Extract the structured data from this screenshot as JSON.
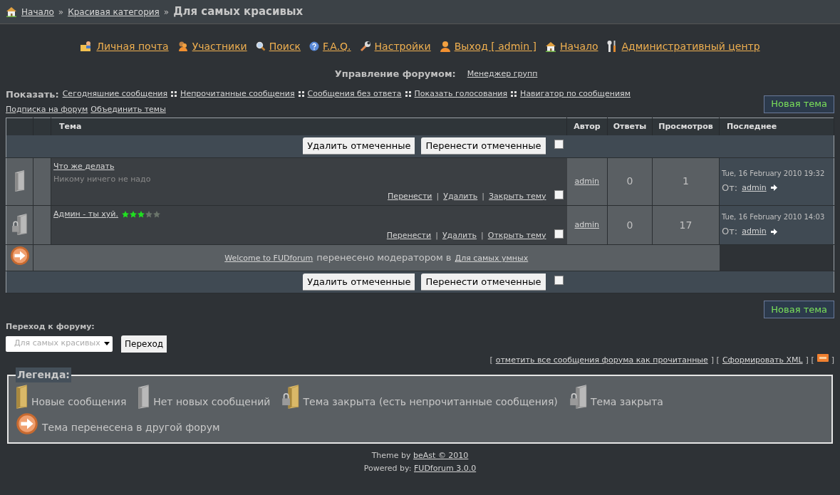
{
  "breadcrumb": {
    "links": [
      "Начало",
      "Красивая категория"
    ],
    "separator": "»",
    "current": "Для самых красивых"
  },
  "nav": [
    {
      "kind": "mail",
      "label": "Личная почта"
    },
    {
      "kind": "users",
      "label": "Участники"
    },
    {
      "kind": "search",
      "label": "Поиск"
    },
    {
      "kind": "help",
      "label": "F.A.Q."
    },
    {
      "kind": "wrench",
      "label": "Настройки"
    },
    {
      "kind": "user",
      "label": "Выход [ admin ]"
    },
    {
      "kind": "home",
      "label": "Начало"
    },
    {
      "kind": "tools",
      "label": "Административный центр"
    }
  ],
  "admin": {
    "label": "Управление форумом:",
    "link": "Менеджер групп"
  },
  "show": {
    "label": "Показать:",
    "links": [
      "Сегодняшние сообщения",
      "Непрочитанные сообщения",
      "Сообщения без ответа",
      "Показать голосования",
      "Навигатор по сообщениям"
    ],
    "links2": [
      "Подписка на форум",
      "Объединить темы"
    ]
  },
  "new_topic_top": "Новая тема",
  "table": {
    "columns": [
      "Тема",
      "Автор",
      "Ответы",
      "Просмотров",
      "Последнее"
    ],
    "bulk_top": {
      "buttons": [
        "Удалить отмеченные",
        "Перенести отмеченные"
      ],
      "checked": false
    },
    "rows": [
      {
        "kind": "topic",
        "locked": false,
        "title": "Что же делать",
        "subtitle": "Никому ничего не надо",
        "actions": [
          "Перенести",
          "Удалить",
          "Закрыть тему"
        ],
        "action_separator": "|",
        "checked": false,
        "author": "admin",
        "replies": "0",
        "views": "1",
        "date": "Tue, 16 February 2010 19:32",
        "from_label": "От:",
        "from": "admin"
      },
      {
        "kind": "topic",
        "locked": true,
        "title": "Админ - ты хуй.",
        "stars": 3,
        "actions": [
          "Перенести",
          "Удалить",
          "Открыть тему"
        ],
        "action_separator": "|",
        "checked": false,
        "author": "admin",
        "replies": "0",
        "views": "17",
        "date": "Tue, 16 February 2010 14:03",
        "from_label": "От:",
        "from": "admin"
      },
      {
        "kind": "moved",
        "link": "Welcome to FUDforum",
        "text": "перенесено модератором в",
        "target": "Для самых умных"
      }
    ],
    "bulk_bottom": {
      "buttons": [
        "Удалить отмеченные",
        "Перенести отмеченные"
      ],
      "checked": false
    }
  },
  "new_topic_bottom": "Новая тема",
  "jump": {
    "label": "Переход к форуму:",
    "value": "Для самых красивых",
    "button": "Переход"
  },
  "tools": {
    "open": "[",
    "mark_read": "отметить все сообщения форума как прочитанные",
    "mid": "] [",
    "xml": "Сформировать XML",
    "mid2": "] [",
    "close": "]"
  },
  "legend": {
    "title": "Легенда:",
    "items": [
      {
        "kind": "new",
        "text": "Новые сообщения"
      },
      {
        "kind": "read",
        "text": "Нет новых сообщений"
      },
      {
        "kind": "new_locked",
        "text": "Тема закрыта (есть непрочитанные сообщения)"
      },
      {
        "kind": "read_locked",
        "text": "Тема закрыта"
      },
      {
        "kind": "moved",
        "text": "Тема перенесена в другой форум"
      }
    ]
  },
  "footer": {
    "theme_label": "Theme by",
    "theme_link": "beAst © 2010",
    "powered_label": "Powered by:",
    "powered_link": "FUDforum 3.0.0"
  }
}
